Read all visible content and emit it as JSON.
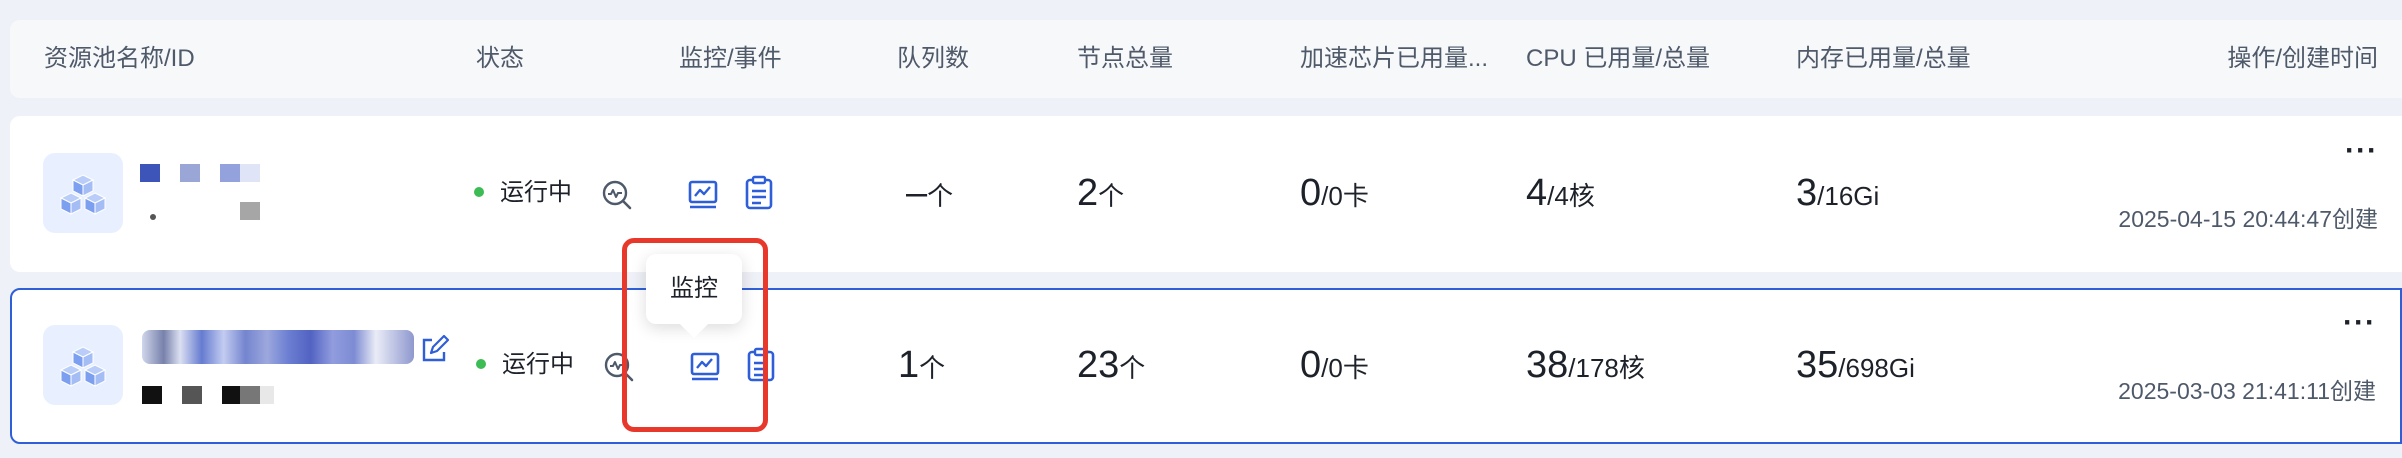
{
  "table": {
    "columns": {
      "name": "资源池名称/ID",
      "status": "状态",
      "monitor_event": "监控/事件",
      "queues": "队列数",
      "nodes": "节点总量",
      "accelerator": "加速芯片已用量...",
      "cpu": "CPU 已用量/总量",
      "memory": "内存已用量/总量",
      "action_created": "操作/创建时间"
    },
    "rows": [
      {
        "status": "运行中",
        "queues_value": "–",
        "queues_unit": "个",
        "nodes_value": "2",
        "nodes_unit": "个",
        "acc_used": "0",
        "acc_total": "/0卡",
        "cpu_used": "4",
        "cpu_total": "/4核",
        "mem_used": "3",
        "mem_total": "/16Gi",
        "more": "···",
        "created": "2025-04-15 20:44:47创建"
      },
      {
        "status": "运行中",
        "queues_value": "1",
        "queues_unit": "个",
        "nodes_value": "23",
        "nodes_unit": "个",
        "acc_used": "0",
        "acc_total": "/0卡",
        "cpu_used": "38",
        "cpu_total": "/178核",
        "mem_used": "35",
        "mem_total": "/698Gi",
        "more": "···",
        "created": "2025-03-03 21:41:11创建"
      }
    ]
  },
  "tooltip": {
    "text": "监控"
  },
  "colors": {
    "accent": "#2f5fd8",
    "status_running": "#3dbb55",
    "highlight": "#e8382c"
  },
  "icons": {
    "pool": "cubes-icon",
    "diagnose": "diagnose-search-icon",
    "monitor": "monitor-chart-icon",
    "event": "clipboard-event-icon",
    "edit": "edit-icon"
  }
}
